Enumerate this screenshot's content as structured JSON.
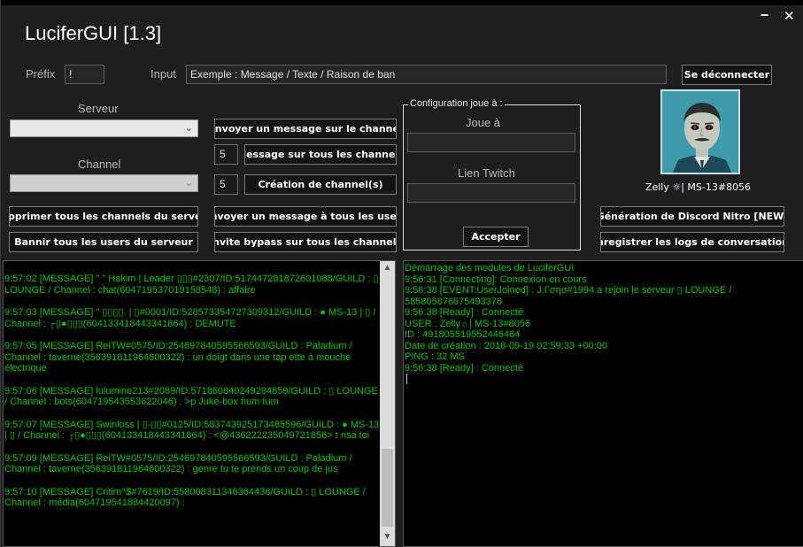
{
  "window": {
    "title": "LuciferGUI [1.3]",
    "minimize_glyph": "🗕",
    "close_glyph": "✕"
  },
  "prefix": {
    "label": "Préfix",
    "value": "!"
  },
  "input": {
    "label": "Input",
    "placeholder": "Exemple : Message / Texte / Raison de ban"
  },
  "disconnect_button": "Se déconnecter",
  "server": {
    "label": "Serveur",
    "value": ""
  },
  "channel": {
    "label": "Channel",
    "value": ""
  },
  "buttons": {
    "send_channel": "Envoyer un message sur le channel",
    "msg_all_channels": "Message sur tous les channels",
    "create_channels": "Création de channel(s)",
    "delete_channels": "Supprimer tous les channels du serveur",
    "send_all_users": "Envoyer un message à tous les users",
    "ban_all": "Bannir tous les users du serveur",
    "invite_bypass": "Invite bypass sur tous les channels",
    "nitro": "Génération de Discord Nitro  [NEW]",
    "save_logs": "Enregistrer les logs de conversations"
  },
  "counts": {
    "msg_all_channels": "5",
    "create_channels": "5"
  },
  "config": {
    "title": "Configuration joue à :",
    "playing_label": "Joue à",
    "playing_value": "",
    "twitch_label": "Lien Twitch",
    "twitch_value": "",
    "accept": "Accepter"
  },
  "profile": {
    "username": "Zelly ☼| MS-13#8056",
    "avatar_icon": "avatar-icon"
  },
  "log_left": [
    {
      "lines": [
        " 9:57:02 [MESSAGE] \" \" Hakim | Leader ▯▯▯#2307/ID:517447281872601088/GUILD : ▯",
        "LOUNGE / Channel : chat(604719537019158548) : affaire"
      ]
    },
    {
      "lines": [
        " 9:57:03 [MESSAGE] \" ▯▯▯▯. | ▯#0001/ID:528573354727309312/GUILD : ● MS-13 |  ▯ /",
        "Channel :  ┌▯●▯▯▯(604133418443341864) : DEMUTE"
      ]
    },
    {
      "lines": [
        " 9:57:05 [MESSAGE] ReiTW#0575/ID:254697840595566593/GUILD : Paladium /",
        "Channel : taverne(356391811964600322) : un doigt dans une tap ette à mouche",
        "électrique"
      ]
    },
    {
      "lines": [
        " 9:57:06 [MESSAGE] lulumine213#2089/ID:571860840249294859/GUILD : ▯ LOUNGE",
        "/ Channel : bots(604719543553622046) : >p Juke-box hum tum"
      ]
    },
    {
      "lines": [
        " 9:57:07 [MESSAGE] Swinloss | ▯-▯▯#0125/ID:583743925173485596/GUILD : ● MS-13",
        "|  ▯ / Channel :  ┌▯●▯▯▯(604133418443341864) : <@436222235049721856> t nsa toi"
      ]
    },
    {
      "lines": [
        " 9:57:09 [MESSAGE] ReiTW#0575/ID:254697840595566593/GUILD : Paladium /",
        "Channel : taverne(356391811964600322) : genre tu te prends un coup de jus"
      ]
    },
    {
      "lines": [
        " 9:57:10 [MESSAGE] Critim^$#7619/ID:558008311346364436/GUILD : ▯ LOUNGE /",
        "Channel : média(604719541884420097) :"
      ]
    }
  ],
  "log_right": [
    " Démarrage des modules de LuciferGUI",
    " 9:56:31 [Connecting]: Connexion en cours",
    " 9:56:38 [EVENT:UserJoined] : J.Γσησ#1994 a rejoin le serveur ▯ LOUNGE /",
    "585805876875493376",
    " 9:56:38 [Ready] : Connecté",
    "  USER : Zelly☼| MS-13#8056",
    " ID : 491805519552446464",
    " Date de création : 2018-09-19 02:59:33 +00:00",
    " PING : 32 MS",
    " 9:56:38 [Ready] : Connecté"
  ]
}
